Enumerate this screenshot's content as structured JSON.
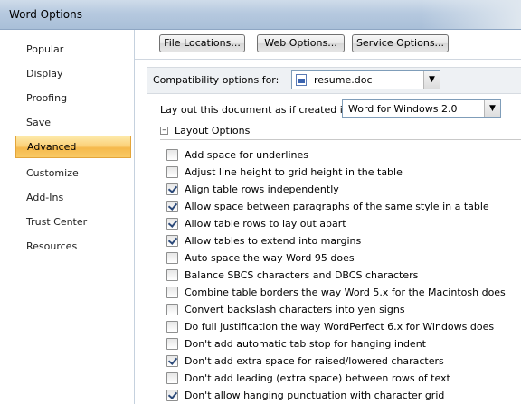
{
  "window": {
    "title": "Word Options"
  },
  "sidebar": {
    "items": [
      {
        "label": "Popular",
        "active": false
      },
      {
        "label": "Display",
        "active": false
      },
      {
        "label": "Proofing",
        "active": false
      },
      {
        "label": "Save",
        "active": false
      },
      {
        "label": "Advanced",
        "active": true
      },
      {
        "label": "Customize",
        "active": false
      },
      {
        "label": "Add-Ins",
        "active": false
      },
      {
        "label": "Trust Center",
        "active": false
      },
      {
        "label": "Resources",
        "active": false
      }
    ]
  },
  "toolbar": {
    "file_locations": "File Locations...",
    "web_options": "Web Options...",
    "service_options": "Service Options..."
  },
  "compatibility": {
    "label": "Compatibility options for:",
    "selected": "resume.doc",
    "icon": "word-document-icon"
  },
  "layout": {
    "label": "Lay out this document as if created in:",
    "selected": "Word for Windows 2.0"
  },
  "layout_options": {
    "title": "Layout Options",
    "items": [
      {
        "label": "Add space for underlines",
        "checked": false
      },
      {
        "label": "Adjust line height to grid height in the table",
        "checked": false
      },
      {
        "label": "Align table rows independently",
        "checked": true
      },
      {
        "label": "Allow space between paragraphs of the same style in a table",
        "checked": true
      },
      {
        "label": "Allow table rows to lay out apart",
        "checked": true
      },
      {
        "label": "Allow tables to extend into margins",
        "checked": true
      },
      {
        "label": "Auto space the way Word 95 does",
        "checked": false
      },
      {
        "label": "Balance SBCS characters and DBCS characters",
        "checked": false
      },
      {
        "label": "Combine table borders the way Word 5.x for the Macintosh does",
        "checked": false
      },
      {
        "label": "Convert backslash characters into yen signs",
        "checked": false
      },
      {
        "label": "Do full justification the way WordPerfect 6.x for Windows does",
        "checked": false
      },
      {
        "label": "Don't add automatic tab stop for hanging indent",
        "checked": false
      },
      {
        "label": "Don't add extra space for raised/lowered characters",
        "checked": true
      },
      {
        "label": "Don't add leading (extra space) between rows of text",
        "checked": false
      },
      {
        "label": "Don't allow hanging punctuation with character grid",
        "checked": true
      }
    ]
  },
  "colors": {
    "title_bar": "#b6c9df",
    "active_nav": "#f8c965",
    "checkmark": "#2c4a7a"
  }
}
